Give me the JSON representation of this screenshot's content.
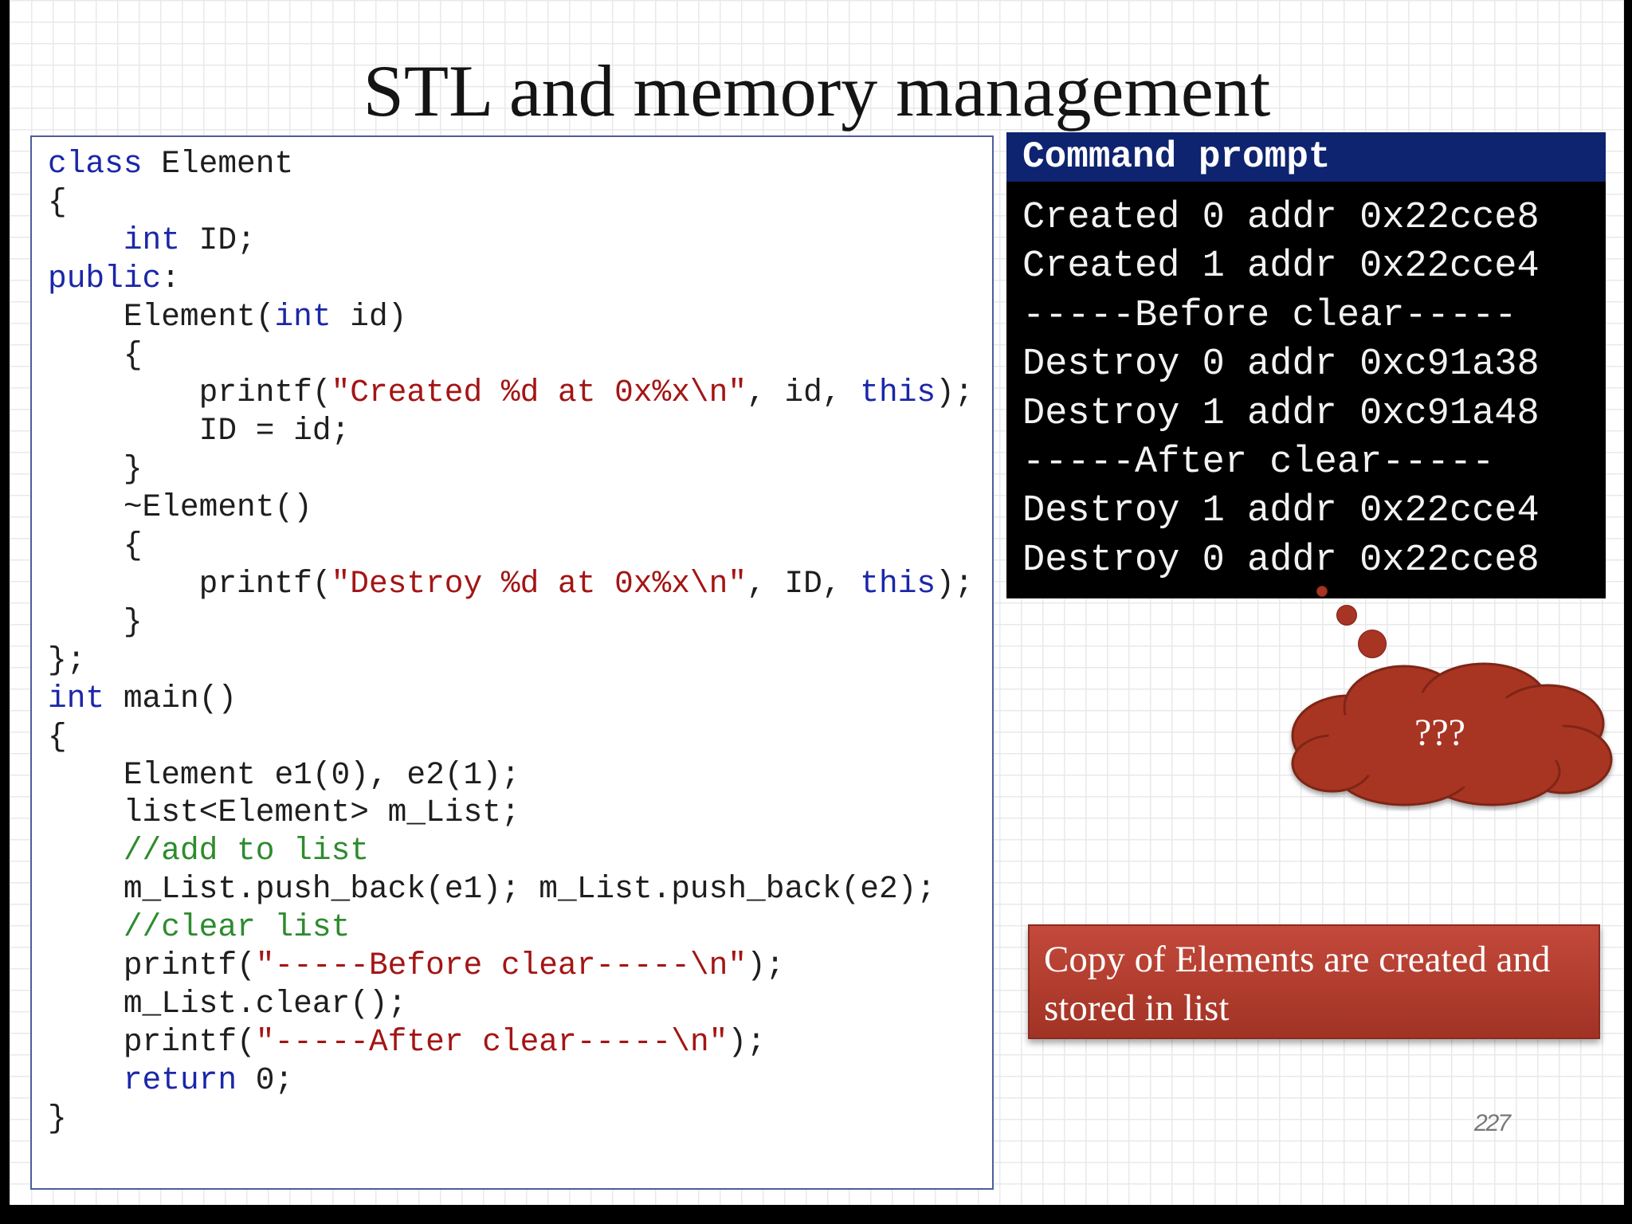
{
  "slide": {
    "title": "STL and memory management",
    "page_number": "227"
  },
  "code": {
    "lines": [
      [
        {
          "t": "class",
          "c": "kw"
        },
        {
          "t": " Element"
        }
      ],
      [
        {
          "t": "{"
        }
      ],
      [
        {
          "t": "    "
        },
        {
          "t": "int",
          "c": "kw"
        },
        {
          "t": " ID;"
        }
      ],
      [
        {
          "t": "public",
          "c": "kw"
        },
        {
          "t": ":"
        }
      ],
      [
        {
          "t": "    Element("
        },
        {
          "t": "int",
          "c": "kw"
        },
        {
          "t": " id)"
        }
      ],
      [
        {
          "t": "    {"
        }
      ],
      [
        {
          "t": "        printf("
        },
        {
          "t": "\"Created %d at 0x%x\\n\"",
          "c": "str"
        },
        {
          "t": ", id, "
        },
        {
          "t": "this",
          "c": "kw"
        },
        {
          "t": ");"
        }
      ],
      [
        {
          "t": "        ID = id;"
        }
      ],
      [
        {
          "t": "    }"
        }
      ],
      [
        {
          "t": "    ~Element()"
        }
      ],
      [
        {
          "t": "    {"
        }
      ],
      [
        {
          "t": "        printf("
        },
        {
          "t": "\"Destroy %d at 0x%x\\n\"",
          "c": "str"
        },
        {
          "t": ", ID, "
        },
        {
          "t": "this",
          "c": "kw"
        },
        {
          "t": ");"
        }
      ],
      [
        {
          "t": "    }"
        }
      ],
      [
        {
          "t": "};"
        }
      ],
      [
        {
          "t": "int",
          "c": "kw"
        },
        {
          "t": " main()"
        }
      ],
      [
        {
          "t": "{"
        }
      ],
      [
        {
          "t": "    Element e1(0), e2(1);"
        }
      ],
      [
        {
          "t": "    list<Element> m_List;"
        }
      ],
      [
        {
          "t": "    "
        },
        {
          "t": "//add to list",
          "c": "cmt"
        }
      ],
      [
        {
          "t": "    m_List.push_back(e1); m_List.push_back(e2);"
        }
      ],
      [
        {
          "t": "    "
        },
        {
          "t": "//clear list",
          "c": "cmt"
        }
      ],
      [
        {
          "t": "    printf("
        },
        {
          "t": "\"-----Before clear-----\\n\"",
          "c": "str"
        },
        {
          "t": ");"
        }
      ],
      [
        {
          "t": "    m_List.clear();"
        }
      ],
      [
        {
          "t": "    printf("
        },
        {
          "t": "\"-----After clear-----\\n\"",
          "c": "str"
        },
        {
          "t": ");"
        }
      ],
      [
        {
          "t": "    "
        },
        {
          "t": "return",
          "c": "kw"
        },
        {
          "t": " 0;"
        }
      ],
      [
        {
          "t": "}"
        }
      ]
    ]
  },
  "command_prompt": {
    "title": "Command prompt",
    "lines": [
      "Created 0 addr 0x22cce8",
      "Created 1 addr 0x22cce4",
      "-----Before clear-----",
      "Destroy 0 addr 0xc91a38",
      "Destroy 1 addr 0xc91a48",
      "-----After clear-----",
      "Destroy 1 addr 0x22cce4",
      "Destroy 0 addr 0x22cce8"
    ]
  },
  "thought_bubble": {
    "text": "???"
  },
  "callout": {
    "text": "Copy of Elements are created and stored in list"
  },
  "colors": {
    "keyword": "#1b27a8",
    "string": "#a31515",
    "comment": "#2e8b2e",
    "console_header": "#0e2470",
    "console_bg": "#000000",
    "callout_bg": "#b03d2e",
    "bubble": "#a83424"
  }
}
